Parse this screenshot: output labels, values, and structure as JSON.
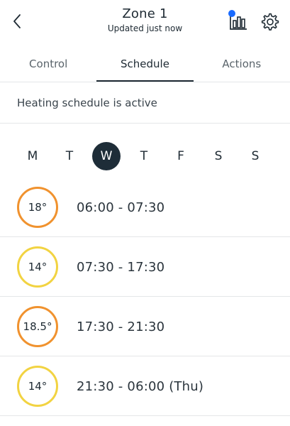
{
  "header": {
    "title": "Zone 1",
    "subtitle": "Updated just now",
    "back_icon": "chevron-left-icon",
    "stats_icon": "bar-chart-icon",
    "settings_icon": "gear-icon",
    "notification_dot_color": "#1a6bff"
  },
  "tabs": [
    {
      "label": "Control",
      "active": false
    },
    {
      "label": "Schedule",
      "active": true
    },
    {
      "label": "Actions",
      "active": false
    }
  ],
  "status": {
    "text": "Heating schedule is active"
  },
  "days": [
    {
      "label": "M",
      "selected": false
    },
    {
      "label": "T",
      "selected": false
    },
    {
      "label": "W",
      "selected": true
    },
    {
      "label": "T",
      "selected": false
    },
    {
      "label": "F",
      "selected": false
    },
    {
      "label": "S",
      "selected": false
    },
    {
      "label": "S",
      "selected": false
    }
  ],
  "colors": {
    "selected_day_bg": "#1e2d38",
    "warm": "#f0922e",
    "cool": "#f2d342"
  },
  "schedule": [
    {
      "temp": "18°",
      "range": "06:00 - 07:30",
      "level": "warm"
    },
    {
      "temp": "14°",
      "range": "07:30 - 17:30",
      "level": "cool"
    },
    {
      "temp": "18.5°",
      "range": "17:30 - 21:30",
      "level": "warm"
    },
    {
      "temp": "14°",
      "range": "21:30 - 06:00 (Thu)",
      "level": "cool"
    }
  ]
}
